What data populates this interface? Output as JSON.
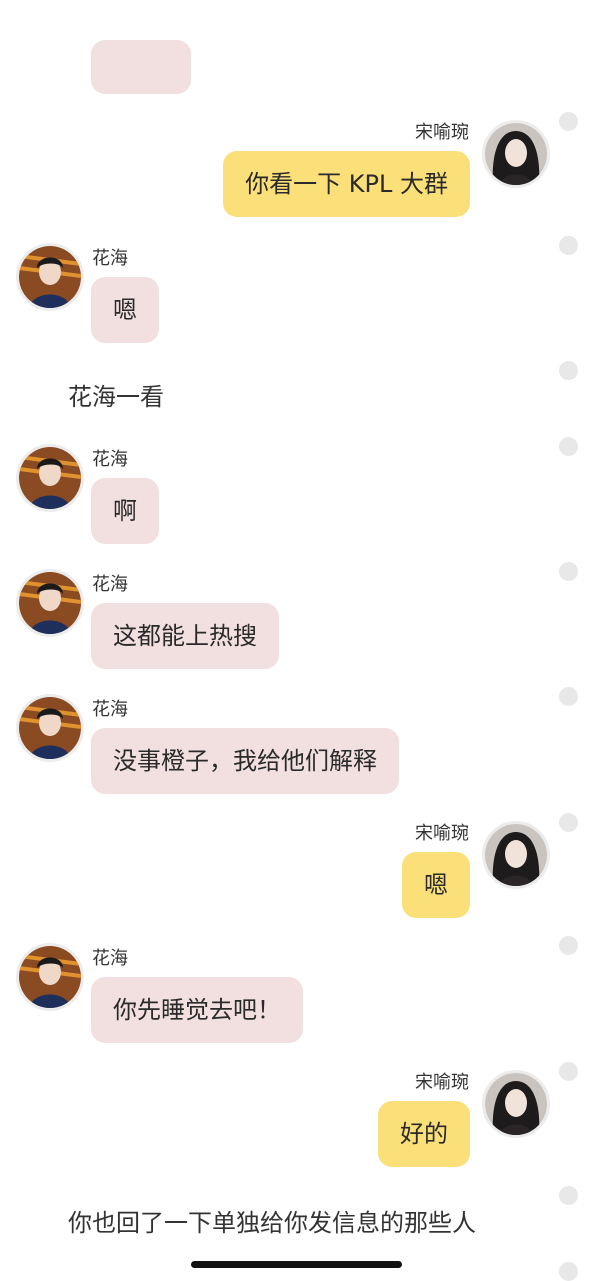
{
  "messages": [
    {
      "side": "right",
      "sender": "宋喻琬",
      "text": "你看一下 KPL 大群"
    },
    {
      "side": "left",
      "sender": "花海",
      "text": "嗯"
    },
    {
      "side": "narration",
      "text": "花海一看"
    },
    {
      "side": "left",
      "sender": "花海",
      "text": "啊"
    },
    {
      "side": "left",
      "sender": "花海",
      "text": "这都能上热搜"
    },
    {
      "side": "left",
      "sender": "花海",
      "text": "没事橙子，我给他们解释"
    },
    {
      "side": "right",
      "sender": "宋喻琬",
      "text": "嗯"
    },
    {
      "side": "left",
      "sender": "花海",
      "text": "你先睡觉去吧！"
    },
    {
      "side": "right",
      "sender": "宋喻琬",
      "text": "好的"
    },
    {
      "side": "narration",
      "text": "你也回了一下单独给你发信息的那些人"
    }
  ],
  "colors": {
    "left_bubble": "#f2e0e1",
    "right_bubble": "#fbe07a",
    "background": "#ffffff",
    "select_dot": "#e8e8e8"
  },
  "icons": {
    "left_avatar": "male-avatar-icon",
    "right_avatar": "female-avatar-icon",
    "select_dot": "select-circle-icon"
  }
}
